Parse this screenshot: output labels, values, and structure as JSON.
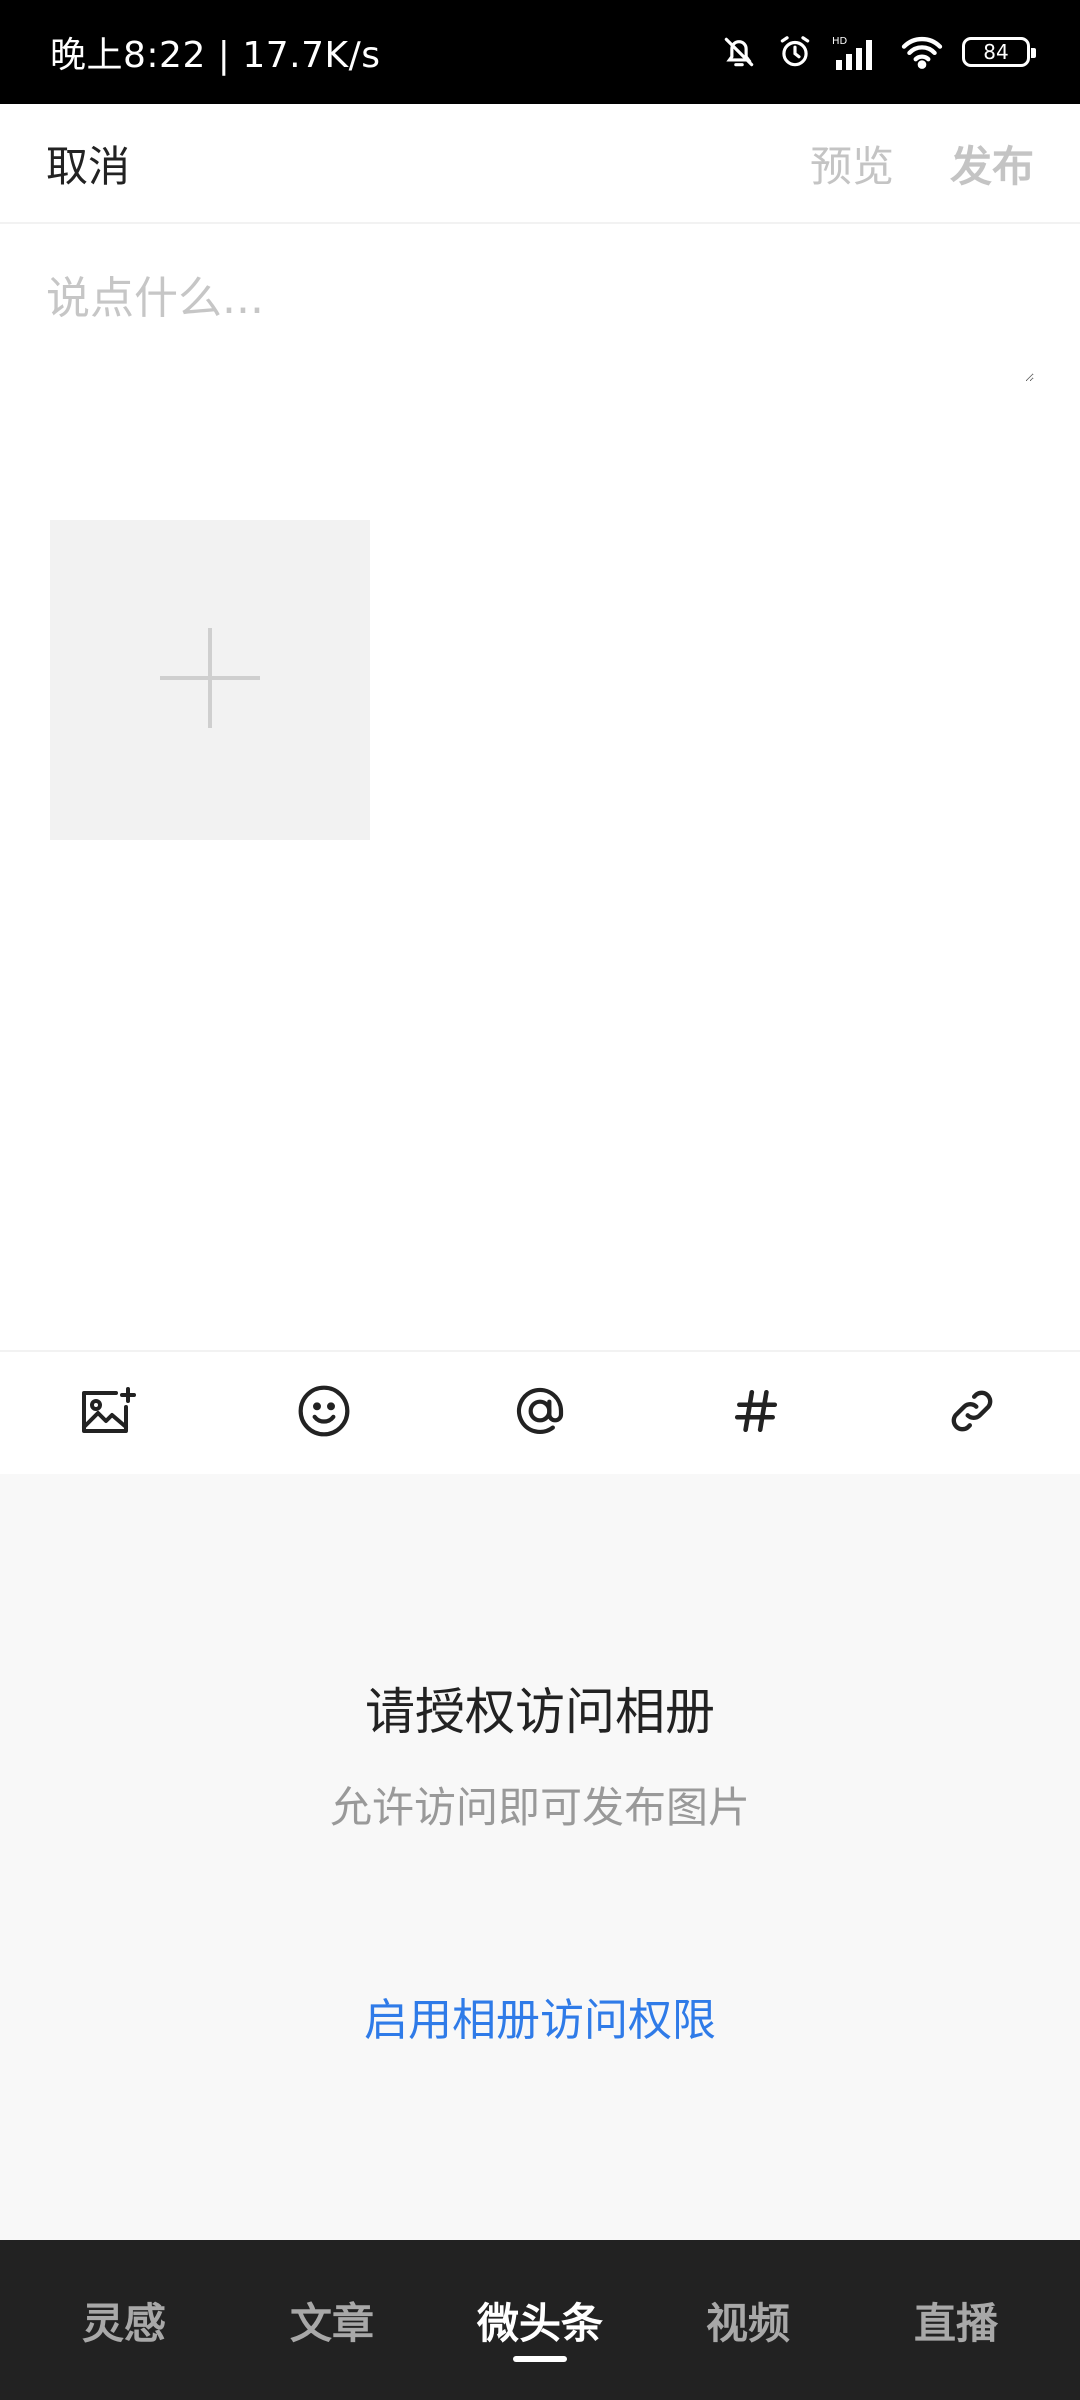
{
  "status_bar": {
    "time_speed": "晚上8:22 | 17.7K/s",
    "battery": "84"
  },
  "header": {
    "cancel_label": "取消",
    "preview_label": "预览",
    "publish_label": "发布"
  },
  "composer": {
    "placeholder": "说点什么..."
  },
  "toolbar": {
    "icons": [
      "add-image-icon",
      "emoji-icon",
      "at-mention-icon",
      "hashtag-icon",
      "link-icon"
    ]
  },
  "permission": {
    "title": "请授权访问相册",
    "description": "允许访问即可发布图片",
    "action_label": "启用相册访问权限"
  },
  "tabs": [
    {
      "label": "灵感",
      "active": false
    },
    {
      "label": "文章",
      "active": false
    },
    {
      "label": "微头条",
      "active": true
    },
    {
      "label": "视频",
      "active": false
    },
    {
      "label": "直播",
      "active": false
    }
  ],
  "colors": {
    "link": "#2f7be8",
    "tab_bar": "#222222",
    "panel": "#f8f8f8"
  }
}
